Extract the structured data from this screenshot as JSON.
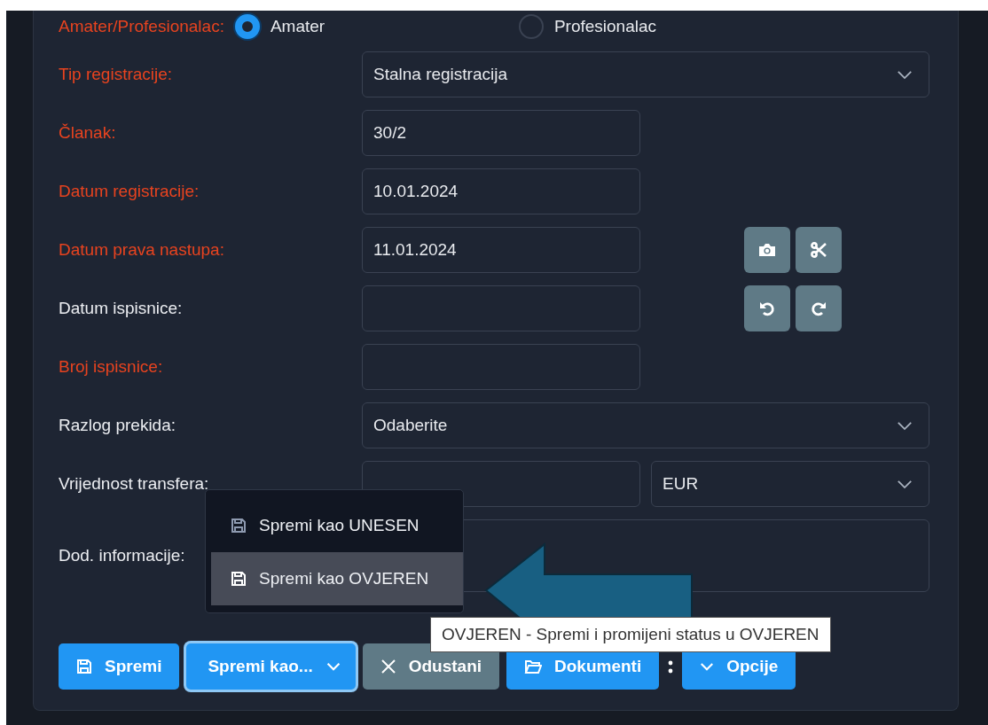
{
  "form": {
    "rows": [
      {
        "kind": "radio",
        "label": "Amater/Profesionalac:",
        "required": true,
        "options": [
          {
            "label": "Amater",
            "selected": true
          },
          {
            "label": "Profesionalac",
            "selected": false
          }
        ]
      },
      {
        "kind": "select",
        "label": "Tip registracije:",
        "required": true,
        "value": "Stalna registracija"
      },
      {
        "kind": "input",
        "label": "Članak:",
        "required": true,
        "value": "30/2"
      },
      {
        "kind": "input",
        "label": "Datum registracije:",
        "required": true,
        "value": "10.01.2024"
      },
      {
        "kind": "input",
        "label": "Datum prava nastupa:",
        "required": true,
        "value": "11.01.2024",
        "tools": [
          {
            "kind": "camera"
          },
          {
            "kind": "scissors"
          }
        ]
      },
      {
        "kind": "input",
        "label": "Datum ispisnice:",
        "required": false,
        "tools": [
          {
            "kind": "undo"
          },
          {
            "kind": "redo"
          }
        ]
      },
      {
        "kind": "input",
        "label": "Broj ispisnice:",
        "required": true
      },
      {
        "kind": "select",
        "label": "Razlog prekida:",
        "required": false,
        "value": "Odaberite"
      },
      {
        "kind": "currency",
        "label": "Vrijednost transfera:",
        "required": false,
        "currency": "EUR"
      },
      {
        "kind": "textarea",
        "label": "Dod. informacije:",
        "required": false
      }
    ]
  },
  "buttons": [
    {
      "kind": "save",
      "label": "Spremi"
    },
    {
      "kind": "split",
      "label": "Spremi kao...",
      "expanded": true
    },
    {
      "kind": "cancel",
      "label": "Odustani"
    },
    {
      "kind": "documents",
      "label": "Dokumenti"
    },
    {
      "kind": "more"
    },
    {
      "kind": "options",
      "label": "Opcije"
    }
  ],
  "menu": {
    "items": [
      {
        "label": "Spremi kao UNESEN",
        "selected": false
      },
      {
        "label": "Spremi kao OVJEREN",
        "selected": true
      }
    ]
  },
  "tooltip": "OVJEREN - Spremi i promijeni status u OVJEREN"
}
